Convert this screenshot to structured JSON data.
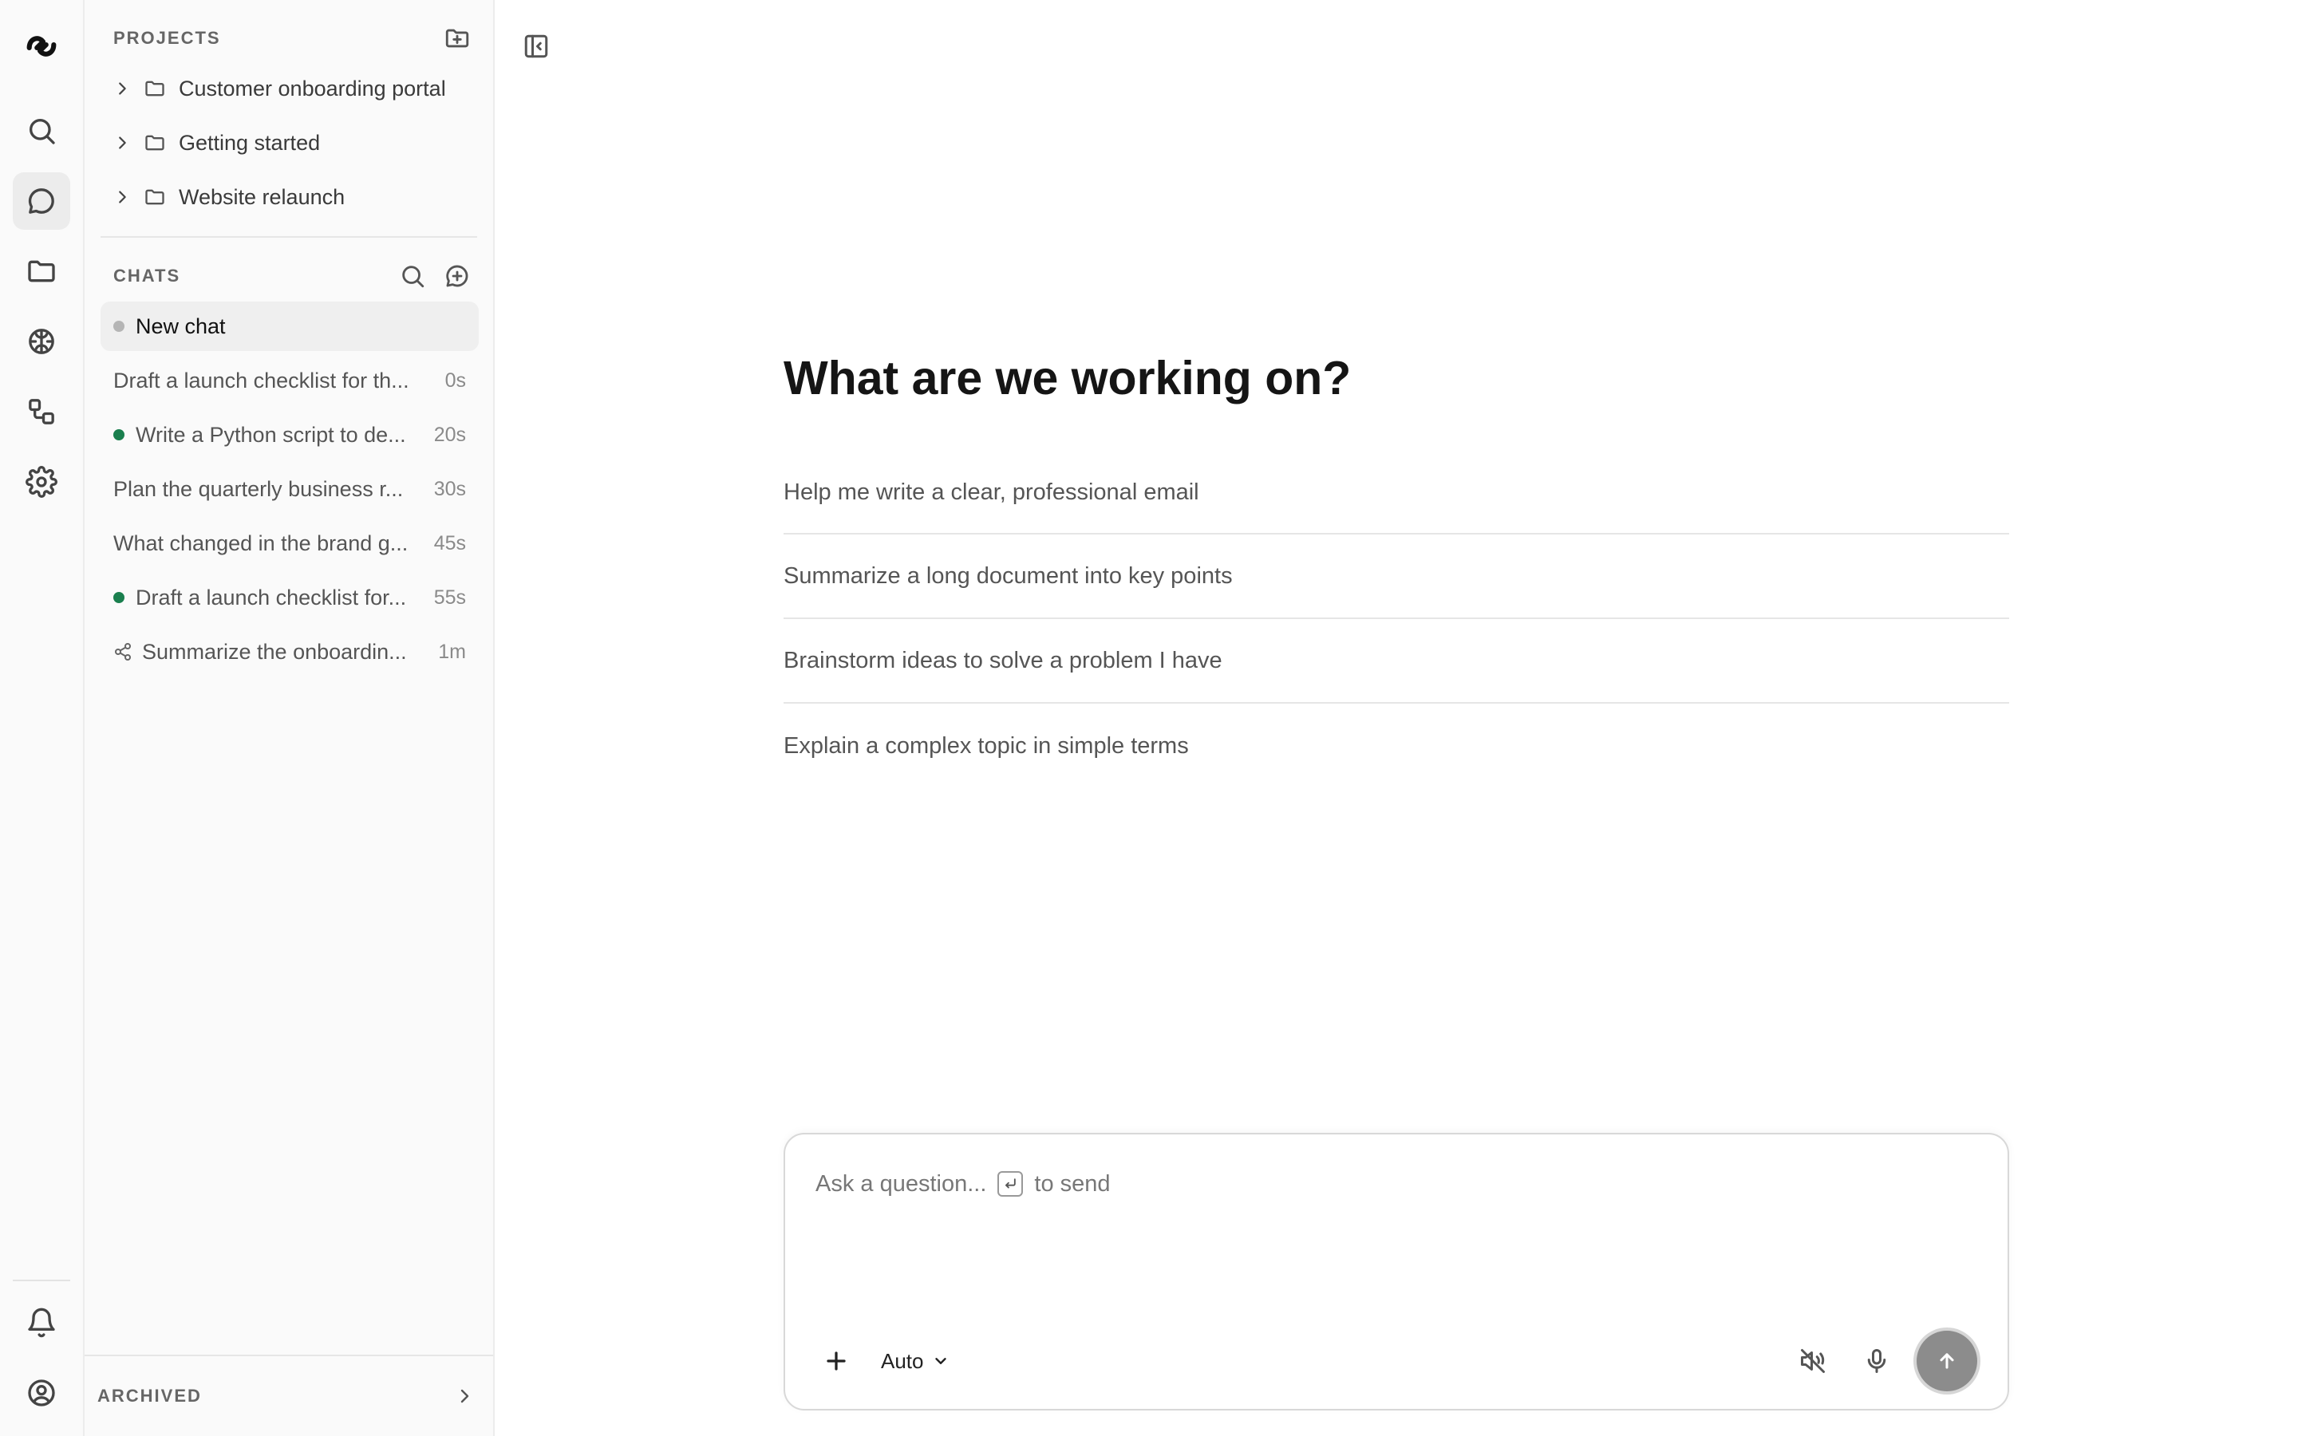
{
  "rail": {
    "logo_icon": "app-logo",
    "items": [
      {
        "icon": "search-icon",
        "active": false
      },
      {
        "icon": "chat-bubble-icon",
        "active": true
      },
      {
        "icon": "folder-icon",
        "active": false
      },
      {
        "icon": "brain-icon",
        "active": false
      },
      {
        "icon": "workflow-icon",
        "active": false
      },
      {
        "icon": "gear-icon",
        "active": false
      }
    ],
    "bottom_items": [
      {
        "icon": "bell-icon"
      },
      {
        "icon": "user-circle-icon"
      }
    ]
  },
  "sidebar": {
    "projects_title": "PROJECTS",
    "projects": [
      {
        "label": "Customer onboarding portal"
      },
      {
        "label": "Getting started"
      },
      {
        "label": "Website relaunch"
      }
    ],
    "chats_title": "CHATS",
    "chats": [
      {
        "title": "New chat",
        "time": "",
        "status": "idle",
        "active": true
      },
      {
        "title": "Draft a launch checklist for th...",
        "time": "0s",
        "status": "none",
        "active": false
      },
      {
        "title": "Write a Python script to de...",
        "time": "20s",
        "status": "done",
        "active": false
      },
      {
        "title": "Plan the quarterly business r...",
        "time": "30s",
        "status": "none",
        "active": false
      },
      {
        "title": "What changed in the brand g...",
        "time": "45s",
        "status": "none",
        "active": false
      },
      {
        "title": "Draft a launch checklist for...",
        "time": "55s",
        "status": "done",
        "active": false
      },
      {
        "title": "Summarize the onboardin...",
        "time": "1m",
        "status": "shared",
        "active": false
      }
    ],
    "archived_label": "ARCHIVED"
  },
  "main": {
    "heading": "What are we working on?",
    "suggestions": [
      "Help me write a clear, professional email",
      "Summarize a long document into key points",
      "Brainstorm ideas to solve a problem I have",
      "Explain a complex topic in simple terms"
    ],
    "composer": {
      "placeholder_prefix": "Ask a question...",
      "placeholder_suffix": "to send",
      "mode": "Auto"
    }
  },
  "colors": {
    "status_done": "#1a7f4e",
    "status_idle": "#b5b5b5",
    "send_button": "#8c8c8c"
  }
}
